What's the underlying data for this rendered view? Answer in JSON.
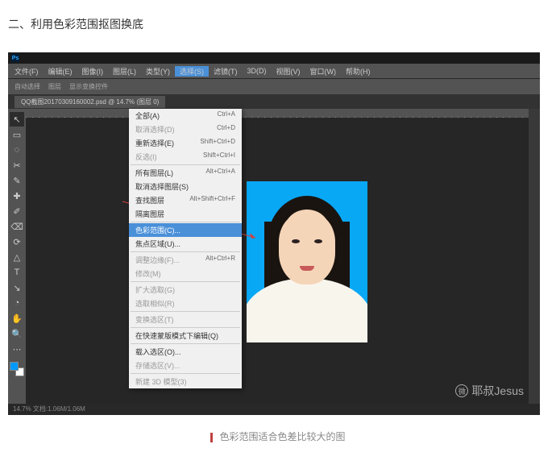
{
  "article": {
    "section_title": "二、利用色彩范围抠图换底",
    "caption": "色彩范围适合色差比较大的图"
  },
  "watermark": {
    "icon": "微",
    "text": "耶叔Jesus"
  },
  "photoshop": {
    "logo": "Ps",
    "menubar": [
      "文件(F)",
      "编辑(E)",
      "图像(I)",
      "图层(L)",
      "类型(Y)",
      "选择(S)",
      "滤镜(T)",
      "3D(D)",
      "视图(V)",
      "窗口(W)",
      "帮助(H)"
    ],
    "menubar_active_index": 5,
    "doctab": "QQ截图20170309160002.psd @ 14.7% (图层 0)",
    "options": {
      "auto_select": "自动选择",
      "layer": "图层",
      "show_transform": "显示变换控件"
    },
    "dropdown": [
      {
        "label": "全部(A)",
        "shortcut": "Ctrl+A"
      },
      {
        "label": "取消选择(D)",
        "shortcut": "Ctrl+D",
        "disabled": true
      },
      {
        "label": "重新选择(E)",
        "shortcut": "Shift+Ctrl+D"
      },
      {
        "label": "反选(I)",
        "shortcut": "Shift+Ctrl+I",
        "disabled": true
      },
      {
        "sep": true
      },
      {
        "label": "所有图层(L)",
        "shortcut": "Alt+Ctrl+A"
      },
      {
        "label": "取消选择图层(S)"
      },
      {
        "label": "查找图层",
        "shortcut": "Alt+Shift+Ctrl+F"
      },
      {
        "label": "隔离图层"
      },
      {
        "sep": true
      },
      {
        "label": "色彩范围(C)...",
        "highlight": true
      },
      {
        "label": "焦点区域(U)..."
      },
      {
        "sep": true
      },
      {
        "label": "调整边缘(F)...",
        "shortcut": "Alt+Ctrl+R",
        "disabled": true
      },
      {
        "label": "修改(M)",
        "disabled": true
      },
      {
        "sep": true
      },
      {
        "label": "扩大选取(G)",
        "disabled": true
      },
      {
        "label": "选取相似(R)",
        "disabled": true
      },
      {
        "sep": true
      },
      {
        "label": "变换选区(T)",
        "disabled": true
      },
      {
        "sep": true
      },
      {
        "label": "在快速蒙版模式下编辑(Q)"
      },
      {
        "sep": true
      },
      {
        "label": "载入选区(O)..."
      },
      {
        "label": "存储选区(V)...",
        "disabled": true
      },
      {
        "sep": true
      },
      {
        "label": "新建 3D 模型(3)",
        "disabled": true
      }
    ],
    "tools": [
      "↖",
      "▭",
      "◌",
      "✂",
      "✎",
      "✚",
      "✐",
      "⌫",
      "⟳",
      "△",
      "T",
      "↘",
      "◔",
      "✋",
      "🔍",
      "⋯"
    ],
    "status": "14.7%   文档:1.06M/1.06M"
  }
}
